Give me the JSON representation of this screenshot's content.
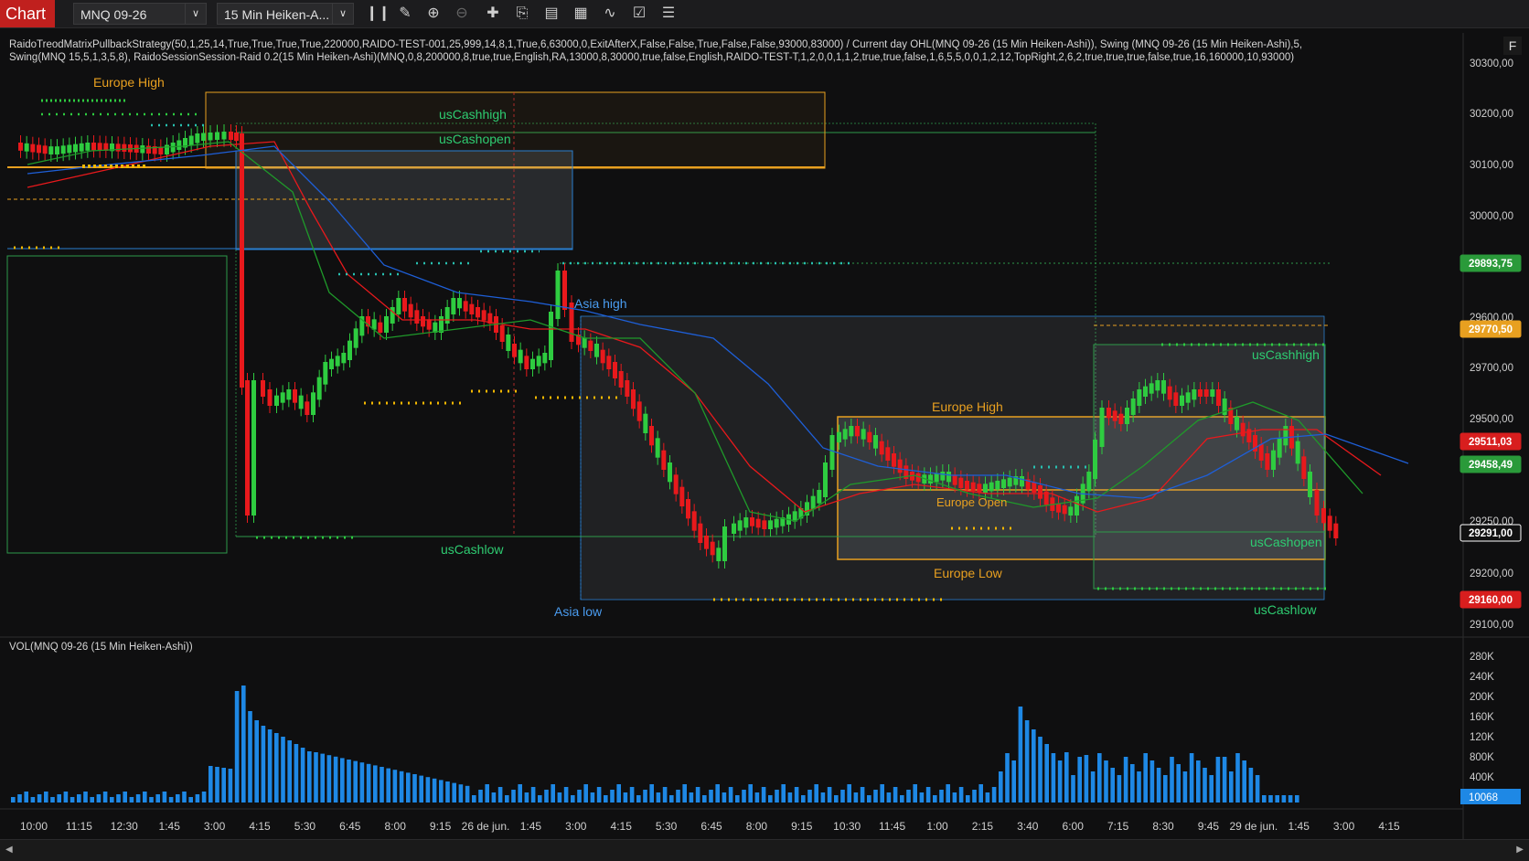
{
  "toolbar": {
    "chart_tab": "Chart",
    "instrument": "MNQ 09-26",
    "timeframe": "15 Min Heiken-A...",
    "tools": [
      "bar-chart-icon",
      "pencil-icon",
      "zoom-in-icon",
      "zoom-out-icon",
      "crosshair-icon",
      "export-icon",
      "split-panel-icon",
      "data-box-icon",
      "indicator-icon",
      "strategy-icon",
      "properties-icon"
    ]
  },
  "indicator_line1": "RaidoTreodMatrixPullbackStrategy(50,1,25,14,True,True,True,True,220000,RAIDO-TEST-001,25,999,14,8,1,True,6,63000,0,ExitAfterX,False,False,True,False,False,93000,83000) / Current day OHL(MNQ 09-26 (15 Min Heiken-Ashi)), Swing (MNQ 09-26 (15 Min Heiken-Ashi),5,",
  "indicator_line2": "Swing(MNQ 15,5,1,3,5,8), RaidoSessionSession-Raid 0.2(15 Min Heiken-Ashi)(MNQ,0,8,200000,8,true,true,English,RA,13000,8,30000,true,false,English,RAIDO-TEST-T,1,2,0,0,1,1,2,true,true,false,1,6,5,5,0,0,1,2,12,TopRight,2,6,2,true,true,true,false,true,16,160000,10,93000)",
  "f_button": "F",
  "vol_title": "VOL(MNQ 09-26 (15 Min Heiken-Ashi))",
  "price_axis": {
    "ticks": [
      "30300,00",
      "30200,00",
      "30100,00",
      "30000,00",
      "29600,00",
      "29700,00",
      "29500,00",
      "29250,00",
      "29200,00",
      "29100,00"
    ],
    "badges": [
      {
        "label": "29893,75",
        "color": "#2a9a3a"
      },
      {
        "label": "29770,50",
        "color": "#e8a020"
      },
      {
        "label": "29511,03",
        "color": "#d81e1e"
      },
      {
        "label": "29458,49",
        "color": "#2a9a3a"
      },
      {
        "label": "29291,00",
        "color": "#111111"
      },
      {
        "label": "29160,00",
        "color": "#d81e1e"
      }
    ]
  },
  "vol_axis": {
    "ticks": [
      "280K",
      "240K",
      "200K",
      "160K",
      "120K",
      "800K",
      "400K"
    ],
    "badge": "10068"
  },
  "time_axis": [
    "10:00",
    "11:15",
    "12:30",
    "1:45",
    "3:00",
    "4:15",
    "5:30",
    "6:45",
    "8:00",
    "9:15",
    "26 de jun.",
    "1:45",
    "3:00",
    "4:15",
    "5:30",
    "6:45",
    "8:00",
    "9:15",
    "10:30",
    "11:45",
    "1:00",
    "2:15",
    "3:40",
    "6:00",
    "7:15",
    "8:30",
    "9:45",
    "29 de jun.",
    "1:45",
    "3:00",
    "4:15"
  ],
  "labels": {
    "europe_high_1": "Europe High",
    "uscash_high_1": "usCashhigh",
    "uscash_open_1": "usCashopen",
    "uscash_low_1": "usCashlow",
    "asia_high": "Asia high",
    "asia_low": "Asia low",
    "europe_high_2": "Europe High",
    "europe_open": "Europe Open",
    "europe_low": "Europe Low",
    "uscash_high_2": "usCashhigh",
    "uscash_open_2": "usCashopen",
    "uscash_low_2": "usCashlow"
  },
  "colors": {
    "bull": "#2ecc40",
    "bear": "#e8191c",
    "volume": "#1e88e5",
    "ema_red": "#e8191c",
    "ema_green": "#1f9a2a",
    "ema_blue": "#1e5fd8",
    "session_orange": "#e8a020",
    "session_green": "#2e9a4a",
    "asia_blue": "#2a7fd0"
  }
}
